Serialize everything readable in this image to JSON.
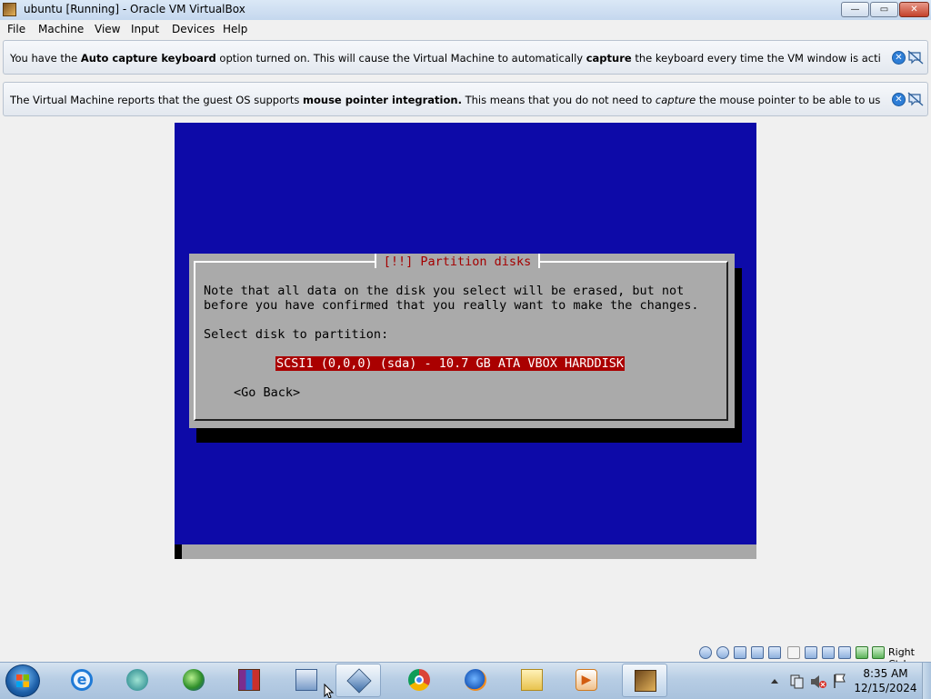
{
  "window": {
    "title": "ubuntu [Running] - Oracle VM VirtualBox",
    "minimize_label": "—",
    "maximize_label": "▭",
    "close_label": "✕"
  },
  "menu": {
    "items": [
      {
        "label": "File"
      },
      {
        "label": "Machine"
      },
      {
        "label": "View"
      },
      {
        "label": "Input"
      },
      {
        "label": "Devices"
      },
      {
        "label": "Help"
      }
    ]
  },
  "notices": [
    {
      "parts": [
        {
          "text": "You have the ",
          "bold": false
        },
        {
          "text": "Auto capture keyboard",
          "bold": true
        },
        {
          "text": " option turned on. This will cause the Virtual Machine to automatically ",
          "bold": false
        },
        {
          "text": "capture",
          "bold": true
        },
        {
          "text": " the keyboard every time the VM window is activated and make it unavailable to",
          "bold": false
        }
      ]
    },
    {
      "parts": [
        {
          "text": "The Virtual Machine reports that the guest OS supports ",
          "bold": false
        },
        {
          "text": "mouse pointer integration.",
          "bold": true
        },
        {
          "text": " This means that you do not need to ",
          "bold": false
        },
        {
          "text": "capture",
          "italic": true
        },
        {
          "text": " the mouse pointer to be able to use it in your guest OS -- all mouse",
          "bold": false
        }
      ]
    }
  ],
  "installer": {
    "dialog_title": "[!!] Partition disks",
    "note_line1": "Note that all data on the disk you select will be erased, but not",
    "note_line2": "before you have confirmed that you really want to make the changes.",
    "prompt": "Select disk to partition:",
    "disk_option": "SCSI1 (0,0,0) (sda) - 10.7 GB ATA VBOX HARDDISK",
    "go_back": "<Go Back>",
    "colors": {
      "background": "#0d0aa8",
      "dialog": "#aaaaaa",
      "title": "#a40000",
      "selection": "#aa0000"
    }
  },
  "statusbar": {
    "icons": [
      "hard-disk-icon",
      "optical-drive-icon",
      "audio-icon",
      "network-icon",
      "usb-icon",
      "shared-folders-icon",
      "display-icon",
      "video-capture-icon",
      "virtualization-icon",
      "mouse-integration-icon"
    ],
    "host_key": "Right Ctrl"
  },
  "taskbar": {
    "apps": [
      "internet-explorer-icon",
      "media-icon",
      "network-globe-icon",
      "winrar-icon",
      "remote-desktop-icon",
      "virtualbox-icon",
      "chrome-icon",
      "firefox-icon",
      "file-explorer-icon",
      "media-player-icon",
      "virtualbox-vm-icon"
    ],
    "time": "8:35 AM",
    "date": "12/15/2024"
  }
}
